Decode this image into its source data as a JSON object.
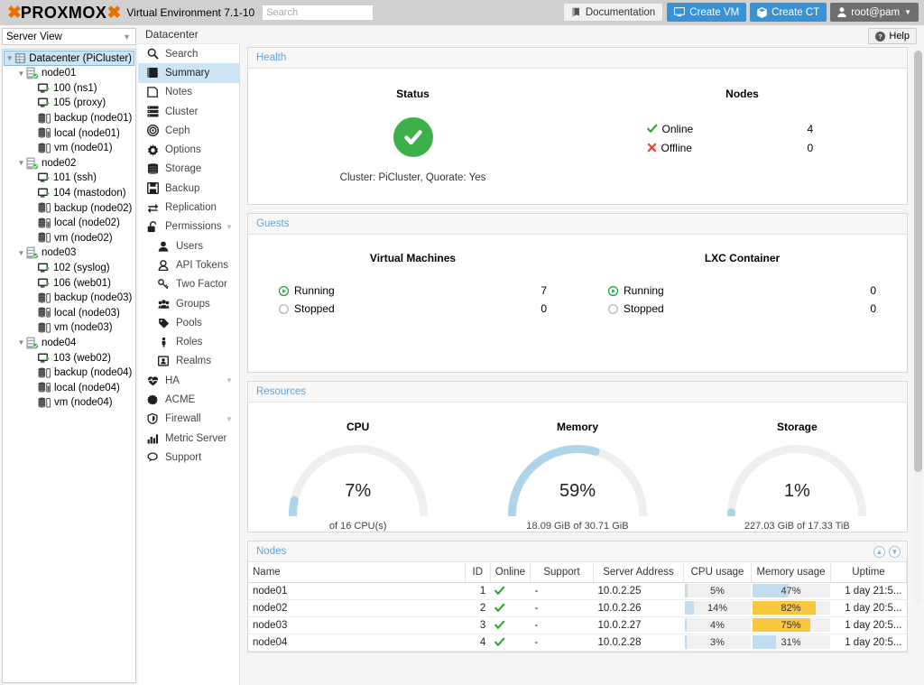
{
  "topbar": {
    "logo_text": "PROXMOX",
    "product": "Virtual Environment 7.1-10",
    "search_placeholder": "Search",
    "documentation": "Documentation",
    "create_vm": "Create VM",
    "create_ct": "Create CT",
    "user": "root@pam"
  },
  "sidebar": {
    "view_selector": "Server View",
    "tree": [
      {
        "label": "Datacenter (PiCluster)",
        "icon": "datacenter-icon",
        "depth": 0,
        "expander": "v",
        "selected": true
      },
      {
        "label": "node01",
        "icon": "node-online-icon",
        "depth": 1,
        "expander": "v",
        "selected": false
      },
      {
        "label": "100 (ns1)",
        "icon": "qemu-running-icon",
        "depth": 2,
        "expander": "",
        "selected": false
      },
      {
        "label": "105 (proxy)",
        "icon": "qemu-running-icon",
        "depth": 2,
        "expander": "",
        "selected": false
      },
      {
        "label": "backup (node01)",
        "icon": "storage-empty-icon",
        "depth": 2,
        "expander": "",
        "selected": false
      },
      {
        "label": "local (node01)",
        "icon": "storage-used-icon",
        "depth": 2,
        "expander": "",
        "selected": false
      },
      {
        "label": "vm (node01)",
        "icon": "storage-empty-icon",
        "depth": 2,
        "expander": "",
        "selected": false
      },
      {
        "label": "node02",
        "icon": "node-online-icon",
        "depth": 1,
        "expander": "v",
        "selected": false
      },
      {
        "label": "101 (ssh)",
        "icon": "qemu-running-icon",
        "depth": 2,
        "expander": "",
        "selected": false
      },
      {
        "label": "104 (mastodon)",
        "icon": "qemu-running-icon",
        "depth": 2,
        "expander": "",
        "selected": false
      },
      {
        "label": "backup (node02)",
        "icon": "storage-empty-icon",
        "depth": 2,
        "expander": "",
        "selected": false
      },
      {
        "label": "local (node02)",
        "icon": "storage-used-icon",
        "depth": 2,
        "expander": "",
        "selected": false
      },
      {
        "label": "vm (node02)",
        "icon": "storage-empty-icon",
        "depth": 2,
        "expander": "",
        "selected": false
      },
      {
        "label": "node03",
        "icon": "node-online-icon",
        "depth": 1,
        "expander": "v",
        "selected": false
      },
      {
        "label": "102 (syslog)",
        "icon": "qemu-running-icon",
        "depth": 2,
        "expander": "",
        "selected": false
      },
      {
        "label": "106 (web01)",
        "icon": "qemu-running-icon",
        "depth": 2,
        "expander": "",
        "selected": false
      },
      {
        "label": "backup (node03)",
        "icon": "storage-empty-icon",
        "depth": 2,
        "expander": "",
        "selected": false
      },
      {
        "label": "local (node03)",
        "icon": "storage-used-icon",
        "depth": 2,
        "expander": "",
        "selected": false
      },
      {
        "label": "vm (node03)",
        "icon": "storage-empty-icon",
        "depth": 2,
        "expander": "",
        "selected": false
      },
      {
        "label": "node04",
        "icon": "node-online-icon",
        "depth": 1,
        "expander": "v",
        "selected": false
      },
      {
        "label": "103 (web02)",
        "icon": "qemu-running-icon",
        "depth": 2,
        "expander": "",
        "selected": false
      },
      {
        "label": "backup (node04)",
        "icon": "storage-empty-icon",
        "depth": 2,
        "expander": "",
        "selected": false
      },
      {
        "label": "local (node04)",
        "icon": "storage-used-icon",
        "depth": 2,
        "expander": "",
        "selected": false
      },
      {
        "label": "vm (node04)",
        "icon": "storage-empty-icon",
        "depth": 2,
        "expander": "",
        "selected": false
      }
    ]
  },
  "nav": {
    "context_title": "Datacenter",
    "items": [
      {
        "label": "Search",
        "icon": "search-icon",
        "sub": false,
        "active": false,
        "caret": false
      },
      {
        "label": "Summary",
        "icon": "book-icon",
        "sub": false,
        "active": true,
        "caret": false
      },
      {
        "label": "Notes",
        "icon": "note-icon",
        "sub": false,
        "active": false,
        "caret": false
      },
      {
        "label": "Cluster",
        "icon": "cluster-icon",
        "sub": false,
        "active": false,
        "caret": false
      },
      {
        "label": "Ceph",
        "icon": "ceph-icon",
        "sub": false,
        "active": false,
        "caret": false
      },
      {
        "label": "Options",
        "icon": "gear-icon",
        "sub": false,
        "active": false,
        "caret": false
      },
      {
        "label": "Storage",
        "icon": "storage-icon",
        "sub": false,
        "active": false,
        "caret": false
      },
      {
        "label": "Backup",
        "icon": "floppy-icon",
        "sub": false,
        "active": false,
        "caret": false
      },
      {
        "label": "Replication",
        "icon": "replication-icon",
        "sub": false,
        "active": false,
        "caret": false
      },
      {
        "label": "Permissions",
        "icon": "unlock-icon",
        "sub": false,
        "active": false,
        "caret": true
      },
      {
        "label": "Users",
        "icon": "user-icon",
        "sub": true,
        "active": false,
        "caret": false
      },
      {
        "label": "API Tokens",
        "icon": "token-icon",
        "sub": true,
        "active": false,
        "caret": false
      },
      {
        "label": "Two Factor",
        "icon": "key-icon",
        "sub": true,
        "active": false,
        "caret": false
      },
      {
        "label": "Groups",
        "icon": "group-icon",
        "sub": true,
        "active": false,
        "caret": false
      },
      {
        "label": "Pools",
        "icon": "tag-icon",
        "sub": true,
        "active": false,
        "caret": false
      },
      {
        "label": "Roles",
        "icon": "person-icon",
        "sub": true,
        "active": false,
        "caret": false
      },
      {
        "label": "Realms",
        "icon": "idcard-icon",
        "sub": true,
        "active": false,
        "caret": false
      },
      {
        "label": "HA",
        "icon": "heartbeat-icon",
        "sub": false,
        "active": false,
        "caret": true
      },
      {
        "label": "ACME",
        "icon": "certificate-icon",
        "sub": false,
        "active": false,
        "caret": false
      },
      {
        "label": "Firewall",
        "icon": "shield-icon",
        "sub": false,
        "active": false,
        "caret": true
      },
      {
        "label": "Metric Server",
        "icon": "chart-icon",
        "sub": false,
        "active": false,
        "caret": false
      },
      {
        "label": "Support",
        "icon": "comment-icon",
        "sub": false,
        "active": false,
        "caret": false
      }
    ]
  },
  "help_button": "Help",
  "health": {
    "panel_title": "Health",
    "status_title": "Status",
    "status_icon": "check-circle-icon",
    "cluster_line": "Cluster: PiCluster, Quorate: Yes",
    "nodes_title": "Nodes",
    "rows": [
      {
        "icon": "check-icon",
        "label": "Online",
        "value": "4"
      },
      {
        "icon": "x-icon",
        "label": "Offline",
        "value": "0"
      }
    ]
  },
  "guests": {
    "panel_title": "Guests",
    "columns": [
      {
        "title": "Virtual Machines",
        "rows": [
          {
            "icon": "play-circle-green-icon",
            "label": "Running",
            "value": "7"
          },
          {
            "icon": "circle-gray-icon",
            "label": "Stopped",
            "value": "0"
          }
        ]
      },
      {
        "title": "LXC Container",
        "rows": [
          {
            "icon": "play-circle-green-icon",
            "label": "Running",
            "value": "0"
          },
          {
            "icon": "circle-gray-icon",
            "label": "Stopped",
            "value": "0"
          }
        ]
      }
    ]
  },
  "resources": {
    "panel_title": "Resources",
    "gauges": [
      {
        "title": "CPU",
        "percent": 7,
        "percent_label": "7%",
        "sub": "of 16 CPU(s)"
      },
      {
        "title": "Memory",
        "percent": 59,
        "percent_label": "59%",
        "sub": "18.09 GiB of 30.71 GiB"
      },
      {
        "title": "Storage",
        "percent": 1,
        "percent_label": "1%",
        "sub": "227.03 GiB of 17.33 TiB"
      }
    ]
  },
  "nodes_table": {
    "panel_title": "Nodes",
    "columns": [
      "Name",
      "ID",
      "Online",
      "Support",
      "Server Address",
      "CPU usage",
      "Memory usage",
      "Uptime"
    ],
    "rows": [
      {
        "name": "node01",
        "id": "1",
        "online": "check-icon",
        "support": "-",
        "address": "10.0.2.25",
        "cpu_pct": 5,
        "cpu_label": "5%",
        "mem_pct": 47,
        "mem_label": "47%",
        "mem_warn": false,
        "uptime": "1 day 21:5..."
      },
      {
        "name": "node02",
        "id": "2",
        "online": "check-icon",
        "support": "-",
        "address": "10.0.2.26",
        "cpu_pct": 14,
        "cpu_label": "14%",
        "mem_pct": 82,
        "mem_label": "82%",
        "mem_warn": true,
        "uptime": "1 day 20:5..."
      },
      {
        "name": "node03",
        "id": "3",
        "online": "check-icon",
        "support": "-",
        "address": "10.0.2.27",
        "cpu_pct": 4,
        "cpu_label": "4%",
        "mem_pct": 75,
        "mem_label": "75%",
        "mem_warn": true,
        "uptime": "1 day 20:5..."
      },
      {
        "name": "node04",
        "id": "4",
        "online": "check-icon",
        "support": "-",
        "address": "10.0.2.28",
        "cpu_pct": 3,
        "cpu_label": "3%",
        "mem_pct": 31,
        "mem_label": "31%",
        "mem_warn": false,
        "uptime": "1 day 20:5..."
      }
    ]
  },
  "colors": {
    "brand_orange": "#e57000",
    "accent_blue": "#3892d4",
    "panel_title_blue": "#5fa2dd",
    "status_green": "#3cb14a",
    "gauge_fill": "#aed4ea",
    "gauge_track": "#efefef",
    "bar_blue": "#c3ddf0",
    "bar_orange": "#fac63e",
    "selection_blue": "#cde4f5"
  }
}
